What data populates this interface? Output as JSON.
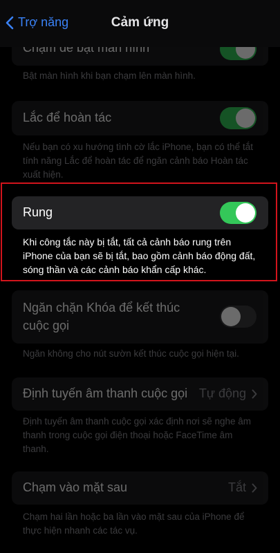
{
  "nav": {
    "back_label": "Trợ năng",
    "title": "Cảm ứng"
  },
  "settings": {
    "tap_to_wake": {
      "label": "Chạm để bật màn hình",
      "enabled": true,
      "footnote": "Bật màn hình khi bạn chạm lên màn hình."
    },
    "shake_to_undo": {
      "label": "Lắc để hoàn tác",
      "enabled": true,
      "footnote": "Nếu bạn có xu hướng tình cờ lắc iPhone, bạn có thể tắt tính năng Lắc để hoàn tác để ngăn cảnh báo Hoàn tác xuất hiện."
    },
    "vibration": {
      "label": "Rung",
      "enabled": true,
      "footnote": "Khi công tắc này bị tắt, tất cả cảnh báo rung trên iPhone của bạn sẽ bị tắt, bao gồm cảnh báo động đất, sóng thần và các cảnh báo khẩn cấp khác."
    },
    "prevent_lock_to_end_call": {
      "label": "Ngăn chặn Khóa để kết thúc cuộc gọi",
      "enabled": false,
      "footnote": "Ngăn không cho nút sườn kết thúc cuộc gọi hiện tại."
    },
    "call_audio_routing": {
      "label": "Định tuyến âm thanh cuộc gọi",
      "value": "Tự động",
      "footnote": "Định tuyến âm thanh cuộc gọi xác định nơi sẽ nghe âm thanh trong cuộc gọi điện thoại hoặc FaceTime âm thanh."
    },
    "back_tap": {
      "label": "Chạm vào mặt sau",
      "value": "Tắt",
      "footnote": "Chạm hai lần hoặc ba lần vào mặt sau của iPhone để thực hiện nhanh các tác vụ."
    }
  },
  "colors": {
    "accent": "#3a82f7",
    "toggle_on": "#34c759",
    "highlight_border": "#d3141c"
  }
}
